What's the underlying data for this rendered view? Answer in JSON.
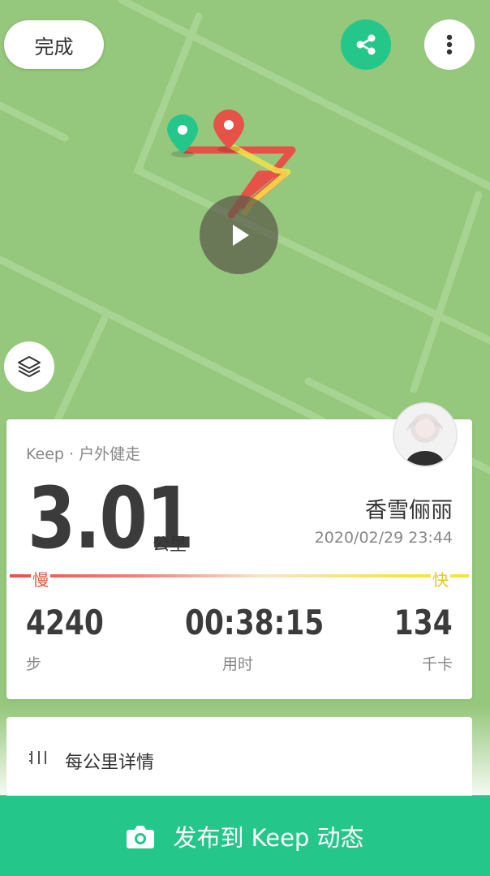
{
  "header": {
    "done_label": "完成"
  },
  "icons": {
    "share": "share-icon",
    "more": "more-vertical-icon",
    "layers": "layers-icon",
    "play": "play-icon",
    "camera": "camera-icon",
    "split": "split-icon"
  },
  "colors": {
    "accent": "#24c789",
    "map_bg": "#95c77c",
    "route_slow": "#e65247",
    "route_fast": "#f4e24a",
    "start_pin": "#24c789",
    "end_pin": "#e65247"
  },
  "summary": {
    "subtitle": "Keep · 户外健走",
    "distance": "3.01",
    "distance_unit": "公里",
    "username": "香雪俪丽",
    "datetime": "2020/02/29 23:44",
    "pace_slow": "慢",
    "pace_fast": "快"
  },
  "stats": {
    "steps": {
      "value": "4240",
      "label": "步"
    },
    "duration": {
      "value": "00:38:15",
      "label": "用时"
    },
    "calories": {
      "value": "134",
      "label": "千卡"
    }
  },
  "splits": {
    "label": "每公里详情"
  },
  "publish": {
    "label": "发布到 Keep 动态"
  }
}
